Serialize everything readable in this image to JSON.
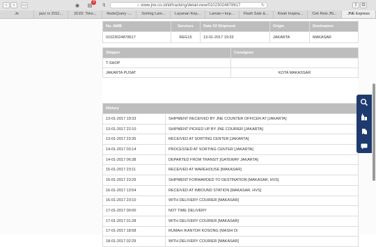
{
  "browser": {
    "url": "www.jne.co.id/id/tracking/detail-new/01023024878617",
    "tabs": [
      "Je",
      "jazz rs 2011...",
      "JDJD: Toko...",
      "NodeQuery -...",
      "Sorting Lam...",
      "Layanan Kep...",
      "Laman • kep...",
      "Flash Sale &...",
      "Kisah Inspira...",
      "Cek Resi JN...",
      "JNE Express"
    ],
    "active_tab": "JNE Express",
    "notification_count": "3"
  },
  "shipment": {
    "headers": [
      "No. AWB",
      "Services",
      "Date Of Shipment",
      "Origin",
      "Destination"
    ],
    "row": [
      "01023024878617",
      "REG15",
      "13-01-2017 19:33",
      "JAKARTA",
      "MAKASAR"
    ]
  },
  "parties": {
    "headers": [
      "Shipper",
      "Consignee"
    ],
    "rows": [
      [
        "T-SHOP",
        ""
      ],
      [
        "JAKARTA PUSAT",
        "KOTA MAKASSAR"
      ]
    ]
  },
  "history": {
    "header": "History",
    "rows": [
      [
        "13-01-2017 19:33",
        "SHIPMENT RECEIVED BY JNE COUNTER OFFICER AT [JAKARTA]"
      ],
      [
        "13-01-2017 22:10",
        "SHIPMENT PICKED UP BY JNE COURIER [JAKARTA]"
      ],
      [
        "13-01-2017 23:35",
        "RECEIVED AT SORTING CENTER [JAKARTA]"
      ],
      [
        "14-01-2017 03:14",
        "PROCESSED AT SORTING CENTER [JAKARTA]"
      ],
      [
        "14-01-2017 06:38",
        "DEPARTED FROM TRANSIT [GATEWAY JAKARTA]"
      ],
      [
        "15-01-2017 23:11",
        "RECEIVED AT WAREHOUSE [MAKASAR]"
      ],
      [
        "15-01-2017 23:29",
        "SHIPMENT FORWARDED TO DESTINATION [MAKASAR, HVS]"
      ],
      [
        "16-01-2017 13:54",
        "RECEIVED AT INBOUND STATION [MAKASAR, HVS]"
      ],
      [
        "16-01-2017 23:10",
        "WITH DELIVERY COURIER [MAKASAR]"
      ],
      [
        "17-01-2017 00:00",
        "NOT TIME DELIVERY"
      ],
      [
        "17-01-2017 01:28",
        "WITH DELIVERY COURIER [MAKASAR]"
      ],
      [
        "17-01-2017 18:58",
        "RUMAH /KANTOR KOSONG (MASIH DI"
      ],
      [
        "18-01-2017 02:29",
        "WITH DELIVERY COURIER [MAKASAR]"
      ]
    ]
  },
  "float_buttons": [
    "search-tracking-icon",
    "building-icon",
    "delivery-icon",
    "chat-icon"
  ],
  "colors": {
    "header_gray": "#bdbdbd",
    "accent_navy": "#1e3a6e"
  }
}
